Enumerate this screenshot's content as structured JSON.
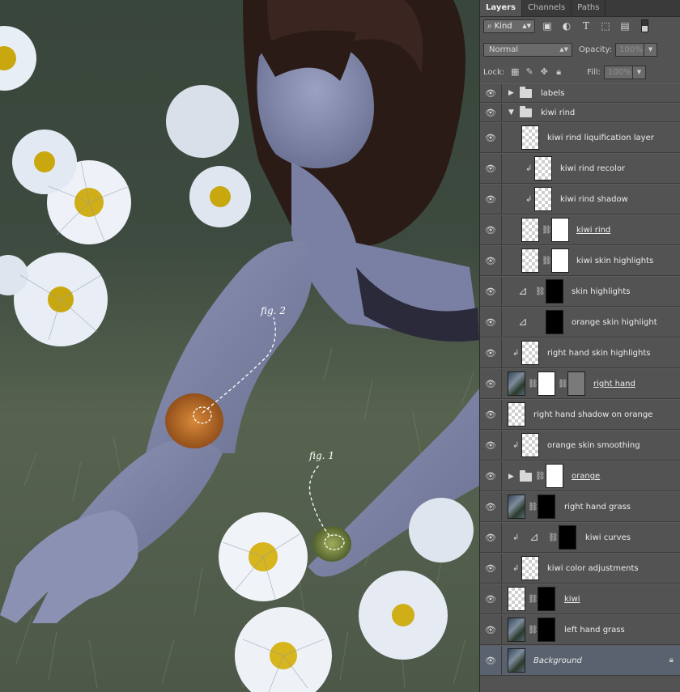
{
  "panel": {
    "tabs": [
      "Layers",
      "Channels",
      "Paths"
    ],
    "filter_kind": "Kind",
    "filter_icons": [
      "image-filter-icon",
      "adjustment-filter-icon",
      "type-filter-icon",
      "shape-filter-icon",
      "smart-object-filter-icon"
    ],
    "blend_mode": "Normal",
    "opacity_label": "Opacity:",
    "opacity_value": "100%",
    "lock_label": "Lock:",
    "fill_label": "Fill:",
    "fill_value": "100%",
    "layers": [
      {
        "name": "labels",
        "kind": "group",
        "collapsed": true
      },
      {
        "name": "kiwi rind",
        "kind": "group",
        "collapsed": false
      },
      {
        "name": "kiwi rind liquification layer"
      },
      {
        "name": "kiwi rind recolor",
        "clipped": true
      },
      {
        "name": "kiwi rind shadow",
        "clipped": true
      },
      {
        "name": "kiwi rind"
      },
      {
        "name": "kiwi skin highlights"
      },
      {
        "name": "skin highlights"
      },
      {
        "name": "orange skin highlight"
      },
      {
        "name": "right hand skin highlights",
        "clipped": true
      },
      {
        "name": "right hand"
      },
      {
        "name": "right hand shadow on orange"
      },
      {
        "name": "orange skin smoothing",
        "clipped": true
      },
      {
        "name": "orange",
        "kind": "group",
        "collapsed": true
      },
      {
        "name": "right hand grass"
      },
      {
        "name": "kiwi curves",
        "clipped": true
      },
      {
        "name": "kiwi color adjustments",
        "clipped": true
      },
      {
        "name": "kiwi"
      },
      {
        "name": "left hand grass"
      },
      {
        "name": "Background",
        "selected": true,
        "locked": true
      }
    ]
  },
  "canvas": {
    "fig2_label": "fig. 2",
    "fig1_label": "fig. 1"
  }
}
